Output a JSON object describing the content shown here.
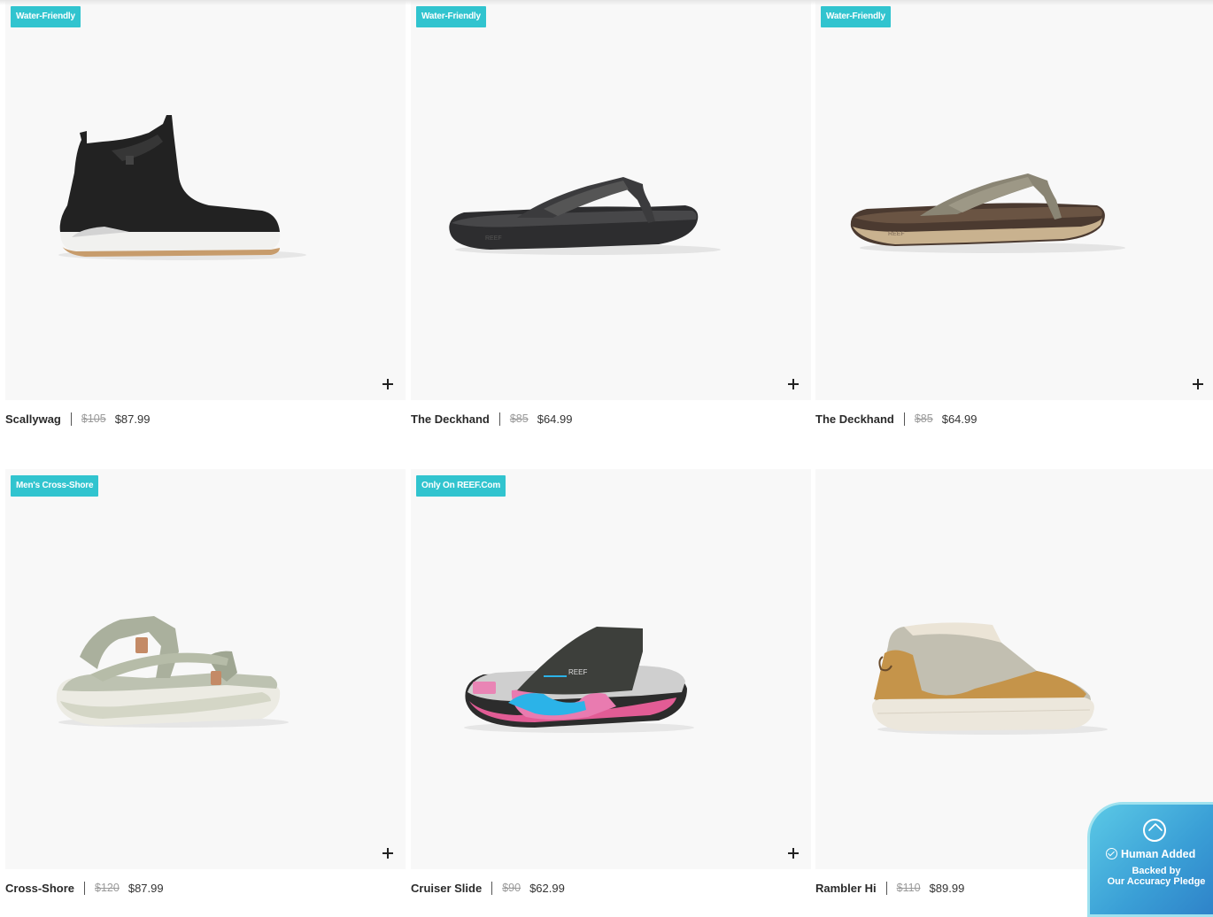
{
  "products": [
    {
      "badge": "Water-Friendly",
      "name": "Scallywag",
      "original_price": "$105",
      "sale_price": "$87.99"
    },
    {
      "badge": "Water-Friendly",
      "name": "The Deckhand",
      "original_price": "$85",
      "sale_price": "$64.99"
    },
    {
      "badge": "Water-Friendly",
      "name": "The Deckhand",
      "original_price": "$85",
      "sale_price": "$64.99"
    },
    {
      "badge": "Men's Cross-Shore",
      "name": "Cross-Shore",
      "original_price": "$120",
      "sale_price": "$87.99"
    },
    {
      "badge": "Only On REEF.Com",
      "name": "Cruiser Slide",
      "original_price": "$90",
      "sale_price": "$62.99"
    },
    {
      "badge": "",
      "name": "Rambler Hi",
      "original_price": "$110",
      "sale_price": "$89.99"
    }
  ],
  "pledge": {
    "title": "Human Added",
    "subtitle_line1": "Backed by",
    "subtitle_line2": "Our Accuracy Pledge"
  },
  "colors": {
    "badge": "#31c4cf",
    "card_background": "#f8f8f8",
    "pledge_gradient_start": "#5bc9e6",
    "pledge_gradient_end": "#2d7fc7"
  },
  "icons": [
    "add-to-cart-plus-icon",
    "shield-icon",
    "check-circle-icon"
  ]
}
